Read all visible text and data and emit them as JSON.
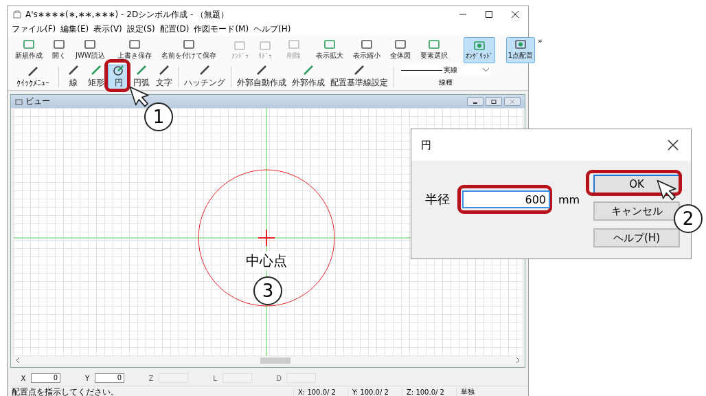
{
  "window": {
    "title": "A's∗∗∗∗(∗,∗∗,∗∗∗) - 2Dシンボル作成 - （無題）"
  },
  "menu": [
    "ファイル(F)",
    "編集(E)",
    "表示(V)",
    "設定(S)",
    "配置(D)",
    "作図モード(M)",
    "ヘルプ(H)"
  ],
  "toolbar_main": [
    {
      "kind": "button",
      "label": "新規作成",
      "disabled": false,
      "selected": false
    },
    {
      "kind": "button",
      "label": "開く",
      "disabled": false,
      "selected": false
    },
    {
      "kind": "button",
      "label": "JWW読込",
      "disabled": false,
      "selected": false
    },
    {
      "kind": "dropdown"
    },
    {
      "kind": "button",
      "label": "上書き保存",
      "disabled": false,
      "selected": false
    },
    {
      "kind": "button",
      "label": "名前を付けて保存",
      "disabled": false,
      "selected": false
    },
    {
      "kind": "separator"
    },
    {
      "kind": "button",
      "label": "ｱﾝﾄﾞｩ",
      "disabled": true,
      "selected": false
    },
    {
      "kind": "button",
      "label": "ﾘﾄﾞｩ",
      "disabled": true,
      "selected": false
    },
    {
      "kind": "separator"
    },
    {
      "kind": "button",
      "label": "削除",
      "disabled": true,
      "selected": false
    },
    {
      "kind": "separator"
    },
    {
      "kind": "button",
      "label": "表示拡大",
      "disabled": false,
      "selected": false
    },
    {
      "kind": "button",
      "label": "表示縮小",
      "disabled": false,
      "selected": false
    },
    {
      "kind": "button",
      "label": "全体図",
      "disabled": false,
      "selected": false
    },
    {
      "kind": "button",
      "label": "要素選択",
      "disabled": false,
      "selected": false
    },
    {
      "kind": "dropdown"
    },
    {
      "kind": "separator"
    },
    {
      "kind": "button",
      "label": "ｵﾝｸﾞﾘｯﾄﾞ",
      "disabled": false,
      "selected": true
    },
    {
      "kind": "separator"
    },
    {
      "kind": "button",
      "label": "1点配置",
      "disabled": false,
      "selected": true
    }
  ],
  "overflow": "»",
  "toolbar_draw": [
    {
      "kind": "button",
      "label": "ｸｲｯｸﾒﾆｭｰ",
      "disabled": false,
      "selected": false
    },
    {
      "kind": "separator"
    },
    {
      "kind": "button",
      "label": "線",
      "disabled": false,
      "selected": false
    },
    {
      "kind": "button",
      "label": "矩形",
      "disabled": false,
      "selected": false
    },
    {
      "kind": "button",
      "label": "円",
      "disabled": false,
      "selected": true
    },
    {
      "kind": "button",
      "label": "円弧",
      "disabled": false,
      "selected": false
    },
    {
      "kind": "button",
      "label": "文字",
      "disabled": false,
      "selected": false
    },
    {
      "kind": "separator"
    },
    {
      "kind": "button",
      "label": "ハッチング",
      "disabled": false,
      "selected": false
    },
    {
      "kind": "separator"
    },
    {
      "kind": "button",
      "label": "外郭自動作成",
      "disabled": false,
      "selected": false
    },
    {
      "kind": "button",
      "label": "外郭作成",
      "disabled": false,
      "selected": false
    },
    {
      "kind": "button",
      "label": "配置基準線設定",
      "disabled": false,
      "selected": false
    },
    {
      "kind": "separator"
    }
  ],
  "line_type": {
    "value": "実線",
    "label": "線種"
  },
  "view": {
    "title": "ビュー",
    "center_label": "中心点"
  },
  "callouts": [
    "1",
    "2",
    "3"
  ],
  "coord_bar": [
    {
      "label": "X",
      "value": "0",
      "disabled": false
    },
    {
      "label": "Y",
      "value": "0",
      "disabled": false
    },
    {
      "label": "Z",
      "disabled": true
    },
    {
      "label": "L",
      "disabled": true
    },
    {
      "label": "D",
      "disabled": true
    }
  ],
  "status_bar": {
    "message": "配置点を指示してください。",
    "cells": [
      "X: 100.0/ 2",
      "Y: 100.0/ 2",
      "Z: 100.0/ 2",
      "単独"
    ]
  },
  "dialog": {
    "title": "円",
    "field_label": "半径",
    "value": "600",
    "unit": "mm",
    "buttons": [
      {
        "label": "OK",
        "selected": true
      },
      {
        "label": "キャンセル",
        "selected": false
      },
      {
        "label": "ヘルプ(H)",
        "selected": false
      }
    ]
  }
}
